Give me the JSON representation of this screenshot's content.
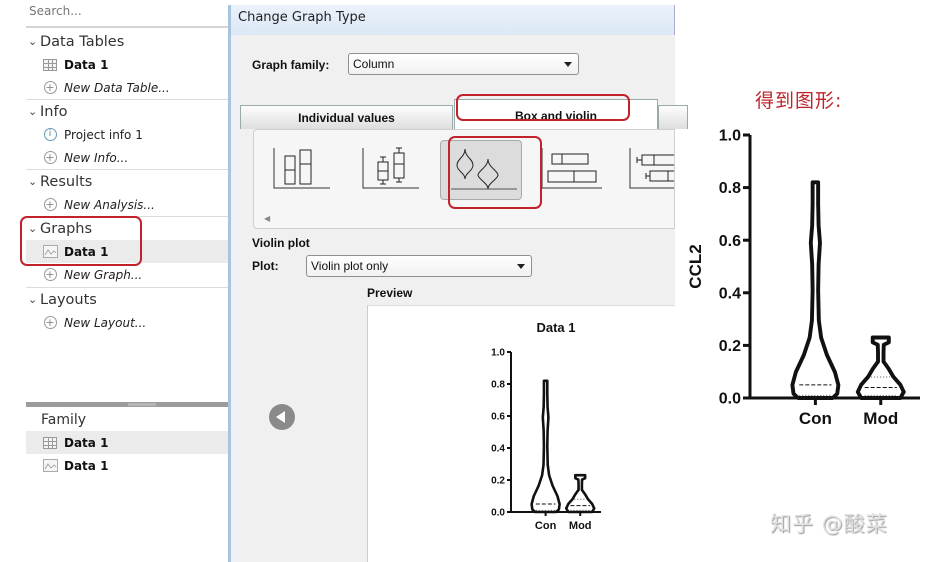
{
  "sidebar": {
    "search_placeholder": "Search...",
    "sections": [
      {
        "label": "Data Tables",
        "items": [
          {
            "label": "Data 1",
            "icon": "data-table-icon",
            "bold": true
          },
          {
            "label": "New Data Table...",
            "icon": "plus-circle-icon",
            "new": true
          }
        ]
      },
      {
        "label": "Info",
        "items": [
          {
            "label": "Project info 1",
            "icon": "info-icon"
          },
          {
            "label": "New Info...",
            "icon": "plus-circle-icon",
            "new": true
          }
        ]
      },
      {
        "label": "Results",
        "items": [
          {
            "label": "New Analysis...",
            "icon": "plus-circle-icon",
            "new": true
          }
        ]
      },
      {
        "label": "Graphs",
        "items": [
          {
            "label": "Data 1",
            "icon": "graph-icon",
            "bold": true,
            "selected": true
          },
          {
            "label": "New Graph...",
            "icon": "plus-circle-icon",
            "new": true
          }
        ]
      },
      {
        "label": "Layouts",
        "items": [
          {
            "label": "New Layout...",
            "icon": "plus-circle-icon",
            "new": true
          }
        ]
      }
    ],
    "family": {
      "label": "Family",
      "items": [
        {
          "label": "Data 1",
          "icon": "data-table-icon",
          "selected": true
        },
        {
          "label": "Data 1",
          "icon": "graph-icon"
        }
      ]
    }
  },
  "dialog": {
    "title": "Change Graph Type",
    "graph_family_label": "Graph family:",
    "graph_family_value": "Column",
    "tabs": [
      {
        "label": "Individual values",
        "active": false
      },
      {
        "label": "Box and violin",
        "active": true
      },
      {
        "label": "",
        "active": false
      }
    ],
    "gallery": [
      {
        "name": "floating-bars-icon",
        "selected": false
      },
      {
        "name": "box-whisker-icon",
        "selected": false
      },
      {
        "name": "violin-icon",
        "selected": true
      },
      {
        "name": "horizontal-bars-icon",
        "selected": false
      },
      {
        "name": "horizontal-box-whisker-icon",
        "selected": false
      }
    ],
    "violin_section_label": "Violin plot",
    "plot_label": "Plot:",
    "plot_value": "Violin plot only",
    "preview_label": "Preview"
  },
  "annotation": "得到图形:",
  "watermark": "知乎 @酸菜",
  "highlight_color": "#c0232b",
  "chart_data": [
    {
      "type": "violin",
      "title": "Data 1",
      "xlabel": "",
      "ylabel": "",
      "categories": [
        "Con",
        "Mod"
      ],
      "ylim": [
        0,
        1.0
      ],
      "yticks": [
        "0.0",
        "0.2",
        "0.4",
        "0.6",
        "0.8",
        "1.0"
      ],
      "series": [
        {
          "name": "Con",
          "min": 0.0,
          "max": 0.82,
          "median": 0.05,
          "q1": 0.01,
          "q3": 0.05
        },
        {
          "name": "Mod",
          "min": 0.0,
          "max": 0.23,
          "median": 0.04,
          "q1": 0.01,
          "q3": 0.08
        }
      ]
    },
    {
      "type": "violin",
      "title": "",
      "xlabel": "",
      "ylabel": "CCL2",
      "categories": [
        "Con",
        "Mod"
      ],
      "ylim": [
        0,
        1.0
      ],
      "yticks": [
        "0.0",
        "0.2",
        "0.4",
        "0.6",
        "0.8",
        "1.0"
      ],
      "series": [
        {
          "name": "Con",
          "min": 0.0,
          "max": 0.82,
          "median": 0.05,
          "q1": 0.01,
          "q3": 0.05
        },
        {
          "name": "Mod",
          "min": 0.0,
          "max": 0.23,
          "median": 0.04,
          "q1": 0.01,
          "q3": 0.08
        }
      ]
    }
  ]
}
